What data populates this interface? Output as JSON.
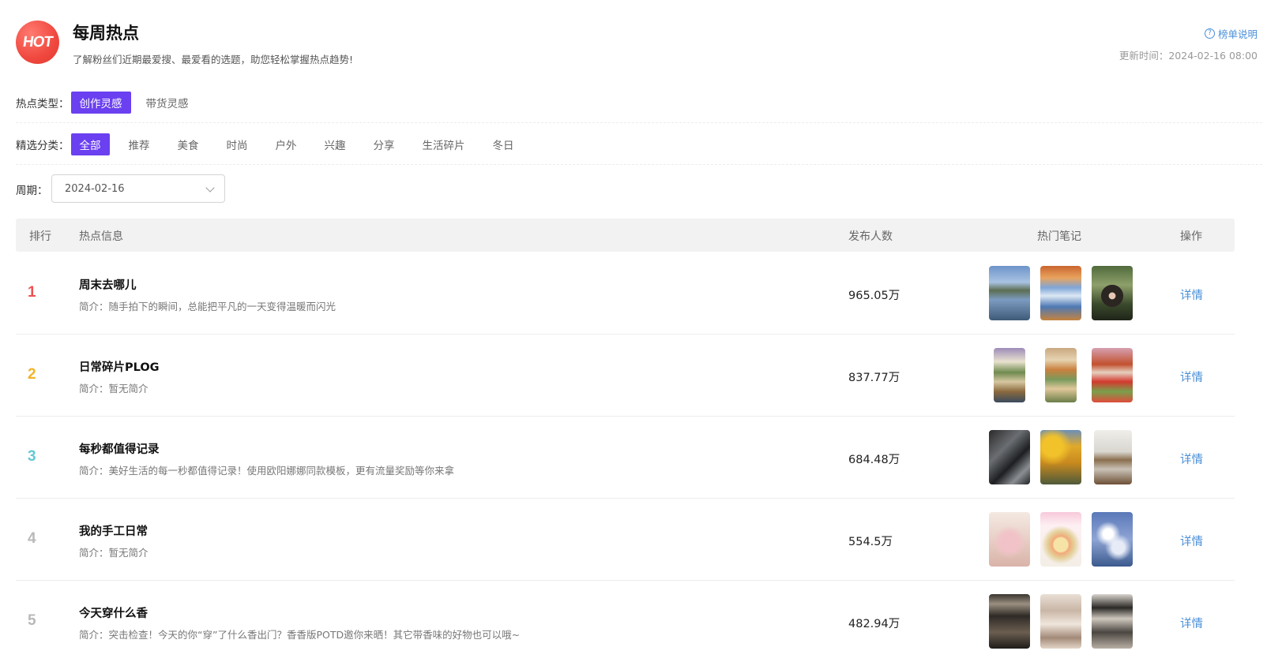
{
  "header": {
    "logo_text": "HOT",
    "title": "每周热点",
    "subtitle": "了解粉丝们近期最爱搜、最爱看的选题，助您轻松掌握热点趋势!",
    "help_label": "榜单说明",
    "update_time": "更新时间：2024-02-16 08:00"
  },
  "filters": {
    "type_label": "热点类型：",
    "types": [
      {
        "label": "创作灵感",
        "active": true
      },
      {
        "label": "带货灵感",
        "active": false
      }
    ],
    "category_label": "精选分类：",
    "categories": [
      {
        "label": "全部",
        "active": true
      },
      {
        "label": "推荐",
        "active": false
      },
      {
        "label": "美食",
        "active": false
      },
      {
        "label": "时尚",
        "active": false
      },
      {
        "label": "户外",
        "active": false
      },
      {
        "label": "兴趣",
        "active": false
      },
      {
        "label": "分享",
        "active": false
      },
      {
        "label": "生活碎片",
        "active": false
      },
      {
        "label": "冬日",
        "active": false
      }
    ],
    "period_label": "周期：",
    "period_value": "2024-02-16"
  },
  "table": {
    "columns": {
      "rank": "排行",
      "info": "热点信息",
      "count": "发布人数",
      "notes": "热门笔记",
      "action": "操作"
    },
    "rows": [
      {
        "rank": "1",
        "rank_color": "#ee5050",
        "title": "周末去哪儿",
        "desc": "简介：随手拍下的瞬间，总能把平凡的一天变得温暖而闪光",
        "count": "965.05万",
        "action": "详情",
        "thumbs": [
          "lake-landscape",
          "autumn-mountain",
          "forest-portrait"
        ]
      },
      {
        "rank": "2",
        "rank_color": "#f0b429",
        "title": "日常碎片PLOG",
        "desc": "简介：暂无简介",
        "count": "837.77万",
        "action": "详情",
        "thumbs": [
          "daily-collage",
          "food-collage",
          "colorful-collage"
        ]
      },
      {
        "rank": "3",
        "rank_color": "#63c7d4",
        "title": "每秒都值得记录",
        "desc": "简介：美好生活的每一秒都值得记录！使用欧阳娜娜同款模板，更有流量奖励等你来拿",
        "count": "684.48万",
        "action": "详情",
        "thumbs": [
          "car-window",
          "yellow-ginkgo",
          "desk-room"
        ]
      },
      {
        "rank": "4",
        "rank_color": "#b8b8b8",
        "title": "我的手工日常",
        "desc": "简介：暂无简介",
        "count": "554.5万",
        "action": "详情",
        "thumbs": [
          "crafted-bag",
          "flower-wreath",
          "blue-flowers"
        ]
      },
      {
        "rank": "5",
        "rank_color": "#b8b8b8",
        "title": "今天穿什么香",
        "desc": "简介：突击检查！今天的你“穿”了什么香出门？香香版POTD邀你来晒！其它带香味的好物也可以哦~",
        "count": "482.94万",
        "action": "详情",
        "thumbs": [
          "elevator-outfit",
          "outfit-collage",
          "outfit-grid"
        ]
      }
    ]
  }
}
